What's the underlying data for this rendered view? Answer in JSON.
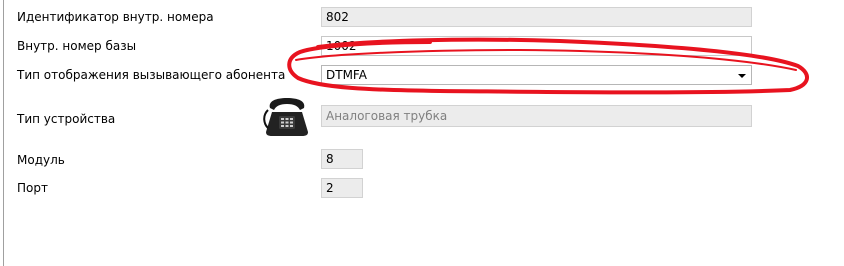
{
  "form": {
    "ext_id_label": "Идентификатор внутр. номера",
    "ext_id_value": "802",
    "base_ext_label": "Внутр. номер базы",
    "base_ext_value": "1002",
    "caller_display_label": "Тип отображения вызывающего абонента",
    "caller_display_value": "DTMFA",
    "device_type_label": "Тип устройства",
    "device_type_value": "Аналоговая трубка",
    "module_label": "Модуль",
    "module_value": "8",
    "port_label": "Порт",
    "port_value": "2"
  },
  "icons": {
    "device_icon": "analog-phone-icon",
    "dropdown_icon": "chevron-down-icon"
  },
  "colors": {
    "annotation": "#e8131f",
    "readonly_bg": "#ececec"
  }
}
